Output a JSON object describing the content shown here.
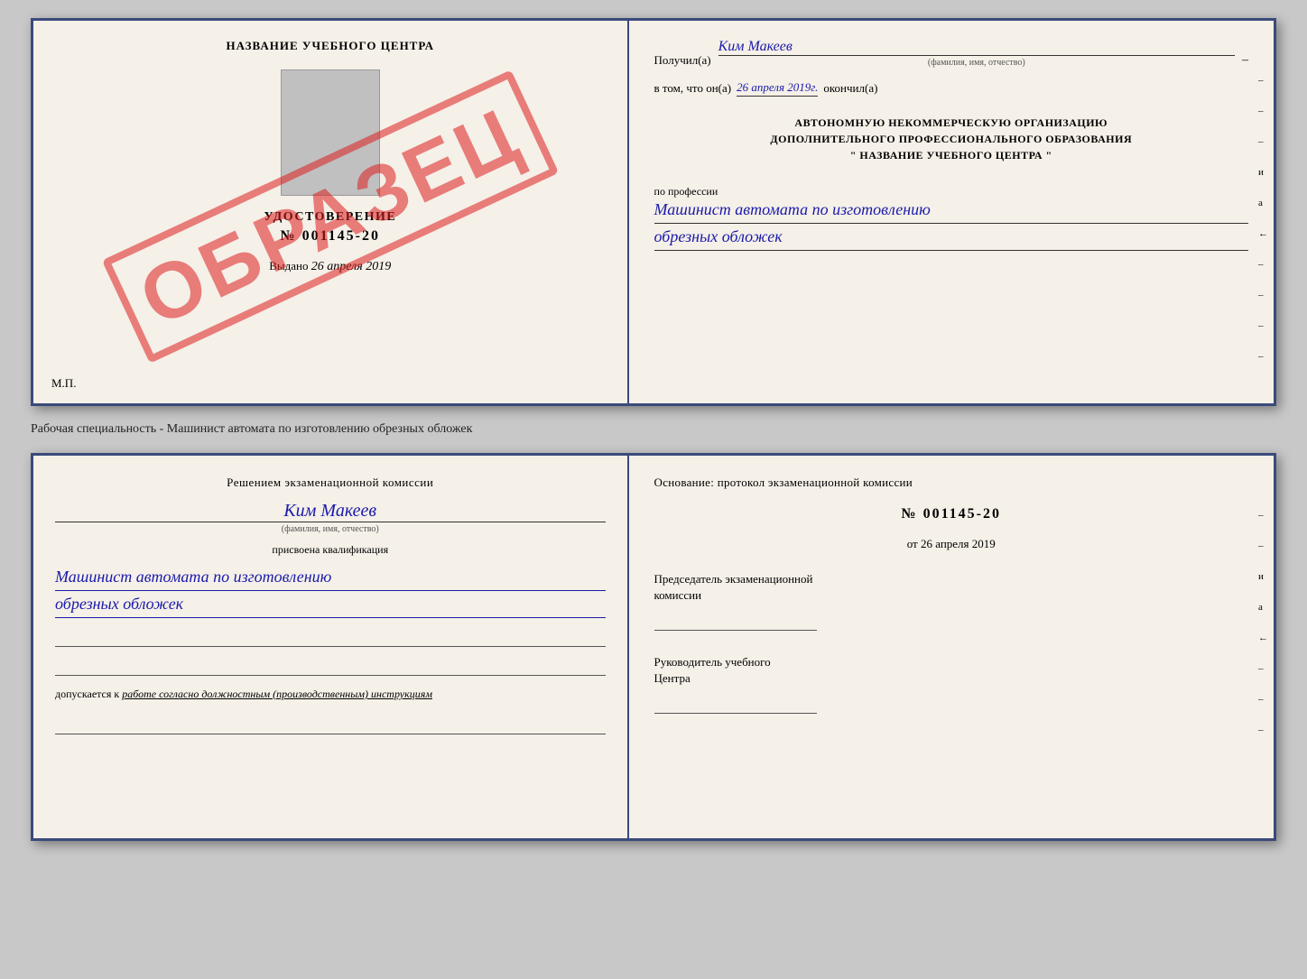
{
  "topDoc": {
    "left": {
      "title": "НАЗВАНИЕ УЧЕБНОГО ЦЕНТРА",
      "stampText": "ОБРАЗЕЦ",
      "certTitle": "УДОСТОВЕРЕНИЕ",
      "certNumber": "№ 001145-20",
      "issuedLabel": "Выдано",
      "issuedDate": "26 апреля 2019",
      "mpLabel": "М.П."
    },
    "right": {
      "recipientLabel": "Получил(а)",
      "recipientName": "Ким Макеев",
      "recipientSubLabel": "(фамилия, имя, отчество)",
      "dateLabel": "в том, что он(а)",
      "date": "26 апреля 2019г.",
      "finishedLabel": "окончил(а)",
      "orgLine1": "АВТОНОМНУЮ НЕКОММЕРЧЕСКУЮ ОРГАНИЗАЦИЮ",
      "orgLine2": "ДОПОЛНИТЕЛЬНОГО ПРОФЕССИОНАЛЬНОГО ОБРАЗОВАНИЯ",
      "orgLine3": "\"  НАЗВАНИЕ УЧЕБНОГО ЦЕНТРА  \"",
      "profLabel": "по профессии",
      "profLine1": "Машинист автомата по изготовлению",
      "profLine2": "обрезных обложек",
      "sideDashes": [
        "-",
        "-",
        "-",
        "и",
        "а",
        "←",
        "-",
        "-",
        "-",
        "-"
      ]
    }
  },
  "caption": "Рабочая специальность - Машинист автомата по изготовлению обрезных обложек",
  "bottomDoc": {
    "left": {
      "decisionText": "Решением экзаменационной комиссии",
      "personName": "Ким Макеев",
      "personSubLabel": "(фамилия, имя, отчество)",
      "assignedText": "присвоена квалификация",
      "qualLine1": "Машинист автомата по изготовлению",
      "qualLine2": "обрезных обложек",
      "allowedText": "допускается к",
      "allowedItalic": "работе согласно должностным (производственным) инструкциям"
    },
    "right": {
      "basisText": "Основание: протокол экзаменационной комиссии",
      "protocolNumber": "№ 001145-20",
      "protocolDateLabel": "от",
      "protocolDate": "26 апреля 2019",
      "chairmanLabel1": "Председатель экзаменационной",
      "chairmanLabel2": "комиссии",
      "directorLabel1": "Руководитель учебного",
      "directorLabel2": "Центра",
      "sideDashes": [
        "-",
        "-",
        "и",
        "а",
        "←",
        "-",
        "-",
        "-"
      ]
    }
  }
}
